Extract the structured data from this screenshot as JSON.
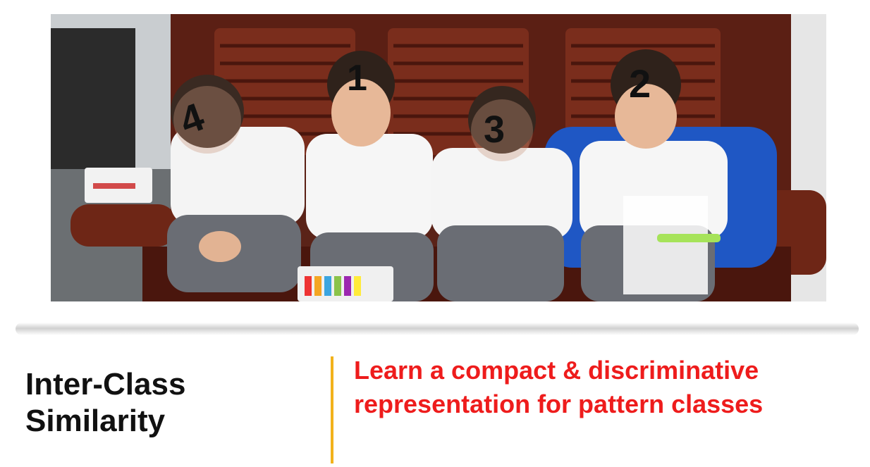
{
  "slide": {
    "heading_line1": "Inter-Class",
    "heading_line2": "Similarity",
    "statement_line1": "Learn a compact & discriminative",
    "statement_line2": "representation for pattern classes"
  },
  "photo": {
    "description_icon": "photo-children-on-bench",
    "head_digits": [
      "4",
      "1",
      "3",
      "2"
    ]
  },
  "colors": {
    "heading": "#111111",
    "statement": "#ee1c1c",
    "accent_line": "#f2b21b",
    "bench": "#5a2318"
  }
}
